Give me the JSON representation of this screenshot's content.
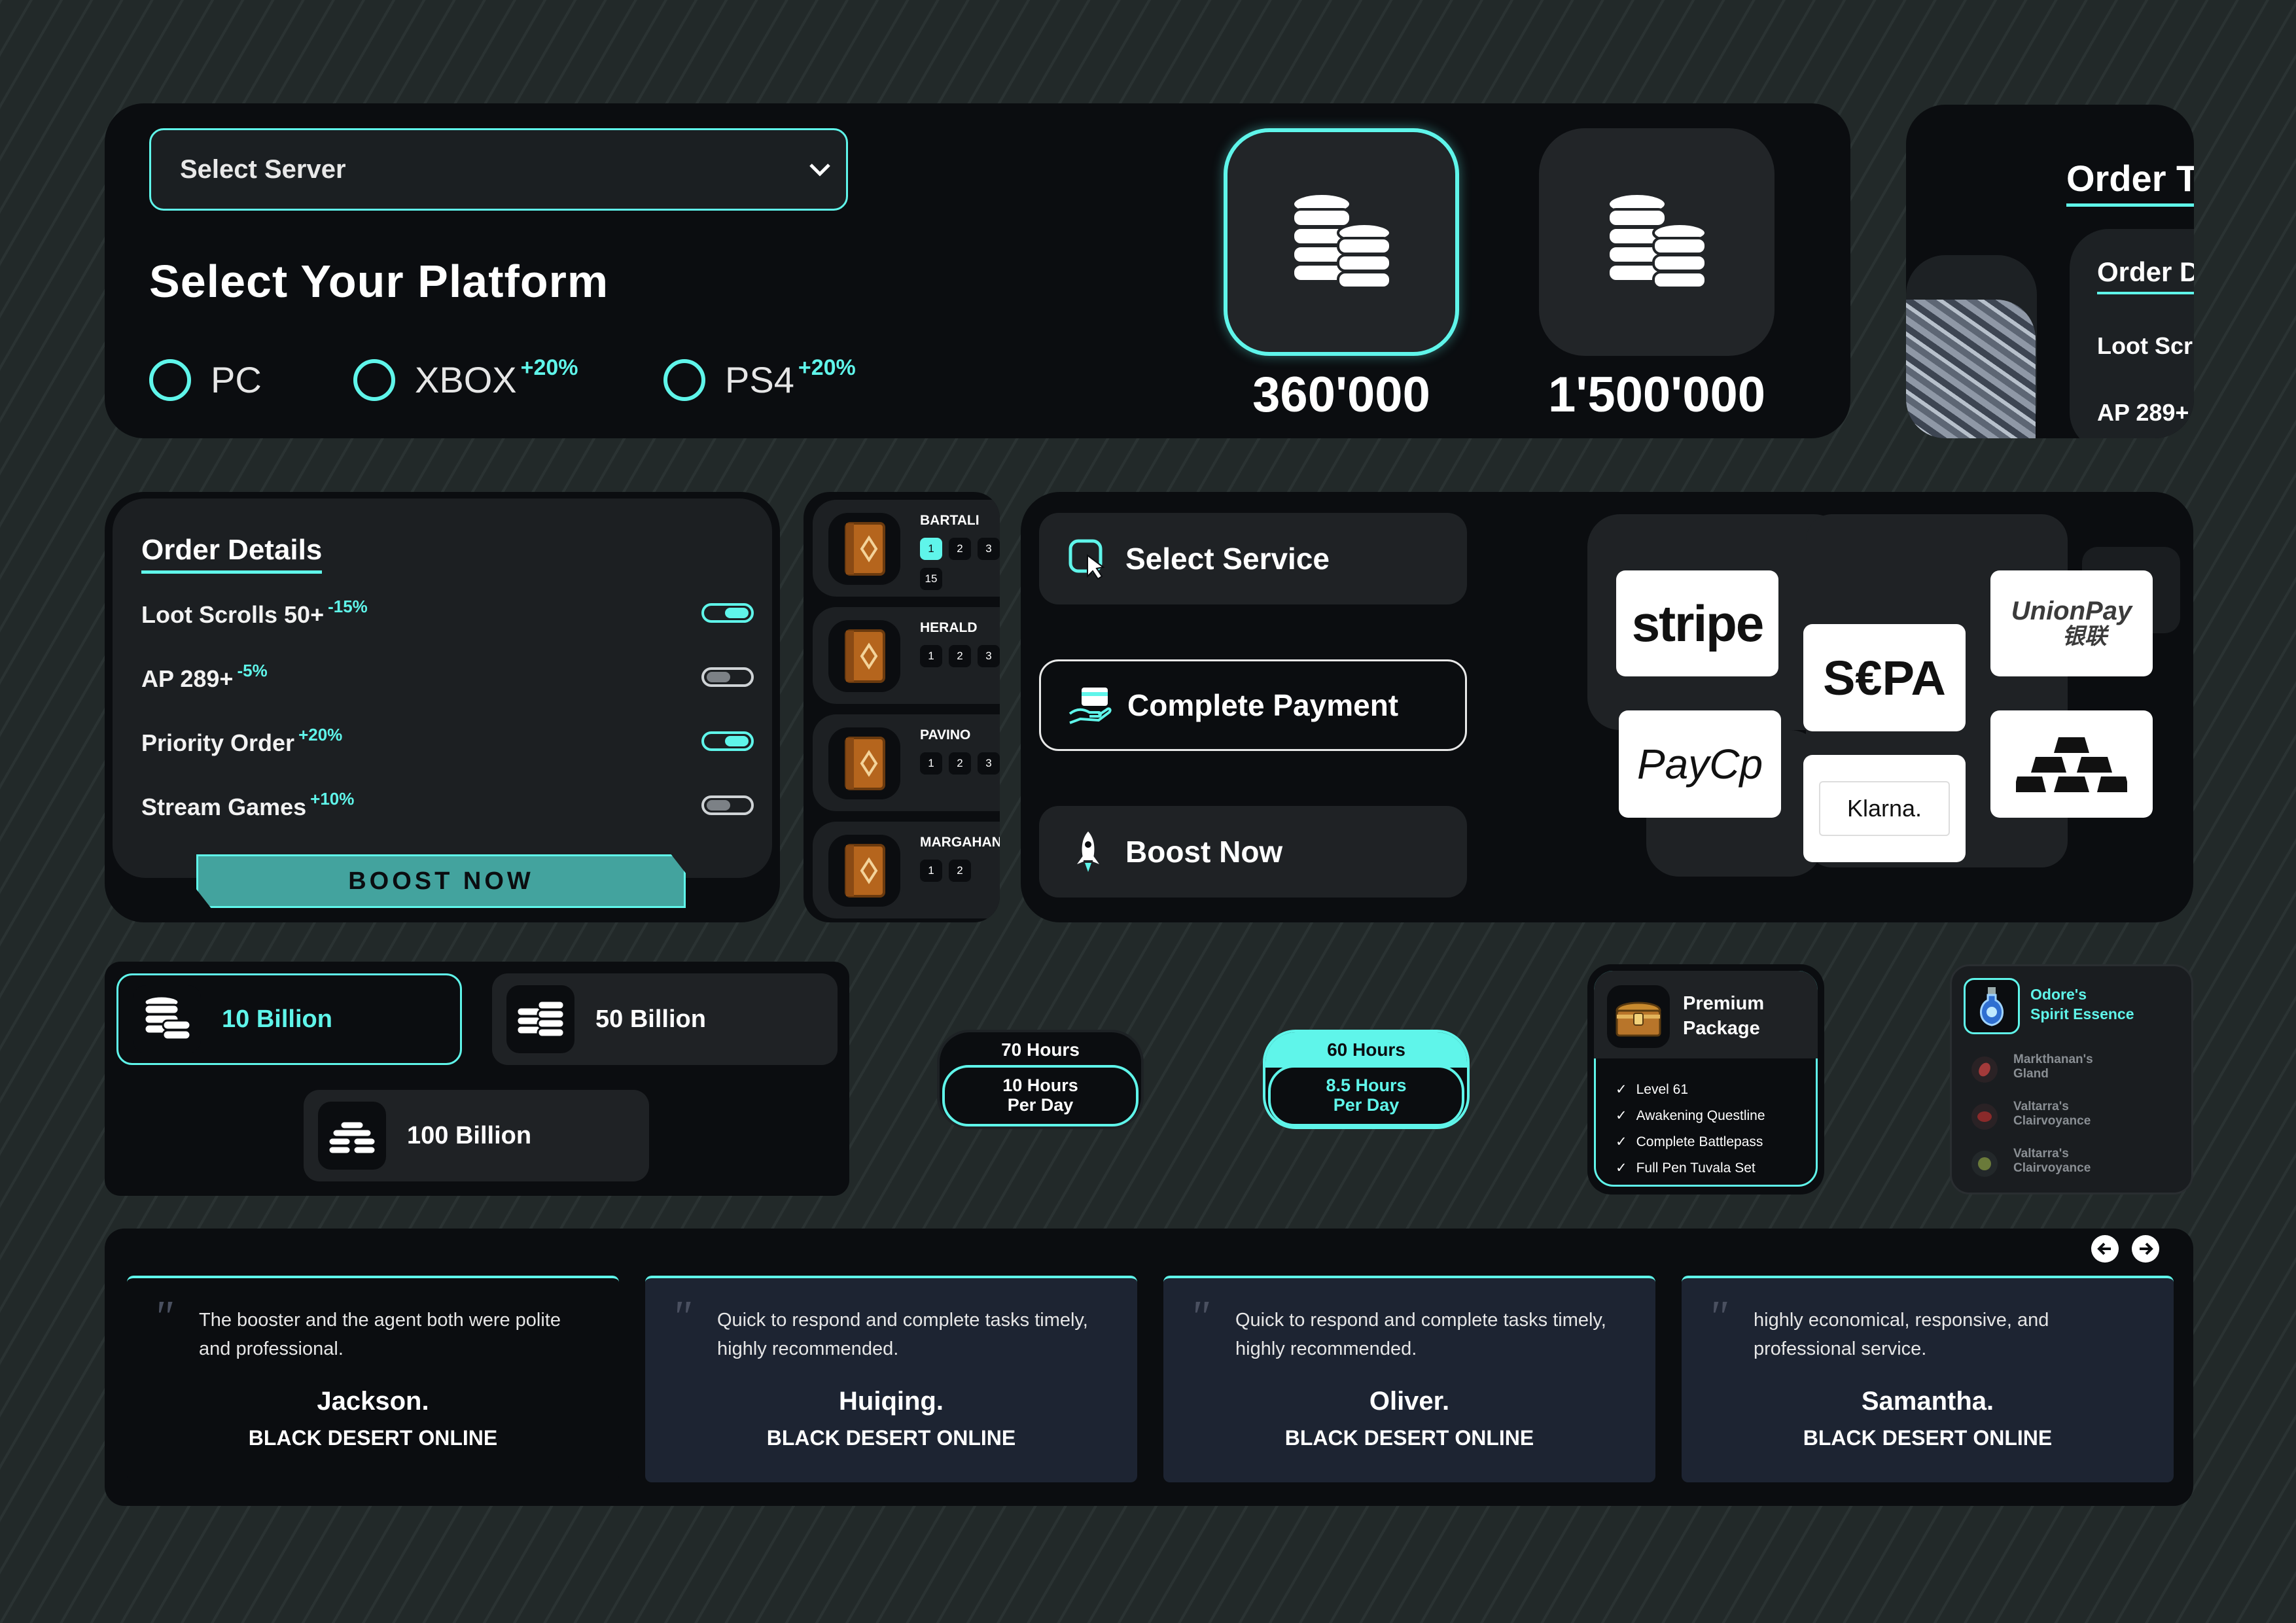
{
  "server_select": {
    "label": "Select Server"
  },
  "platform": {
    "title": "Select Your Platform",
    "options": [
      {
        "label": "PC",
        "bonus": ""
      },
      {
        "label": "XBOX",
        "bonus": "+20%"
      },
      {
        "label": "PS4",
        "bonus": "+20%"
      }
    ]
  },
  "coins": [
    {
      "amount": "360'000",
      "selected": true
    },
    {
      "amount": "1'500'000",
      "selected": false
    }
  ],
  "cropped_order": {
    "title": "Order T",
    "subtitle": "Order D",
    "line1": "Loot Scr",
    "line2": "AP 289+"
  },
  "order_details": {
    "title": "Order Details",
    "items": [
      {
        "label": "Loot Scrolls 50+",
        "mod": "-15%",
        "on": true
      },
      {
        "label": "AP 289+",
        "mod": "-5%",
        "on": false
      },
      {
        "label": "Priority Order",
        "mod": "+20%",
        "on": true
      },
      {
        "label": "Stream Games",
        "mod": "+10%",
        "on": false
      }
    ],
    "button": "BOOST NOW"
  },
  "books": [
    {
      "name": "BARTALI",
      "pages": [
        "1",
        "2",
        "3",
        "15"
      ]
    },
    {
      "name": "HERALD",
      "pages": [
        "1",
        "2",
        "3"
      ]
    },
    {
      "name": "PAVINO",
      "pages": [
        "1",
        "2",
        "3"
      ]
    },
    {
      "name": "MARGAHAN",
      "pages": [
        "1",
        "2"
      ]
    }
  ],
  "steps": [
    {
      "label": "Select Service",
      "icon": "cursor-target-icon"
    },
    {
      "label": "Complete Payment",
      "icon": "card-hand-icon"
    },
    {
      "label": "Boost Now",
      "icon": "rocket-icon"
    }
  ],
  "payments": {
    "stripe": "stripe",
    "sepa": "S€PA",
    "unionpay": "UnionPay",
    "unionpay_cn": "银联",
    "paycop": "PayCp",
    "klarna": "Klarna.",
    "gold_icon": "gold-bars-icon"
  },
  "billions": [
    {
      "label": "10 Billion",
      "selected": true
    },
    {
      "label": "50 Billion",
      "selected": false
    },
    {
      "label": "100 Billion",
      "selected": false
    }
  ],
  "hours": [
    {
      "total": "70 Hours",
      "per_day_value": "10 Hours",
      "per_day_unit": "Per Day",
      "selected": false
    },
    {
      "total": "60 Hours",
      "per_day_value": "8.5 Hours",
      "per_day_unit": "Per Day",
      "selected": true
    }
  ],
  "premium": {
    "title_line1": "Premium",
    "title_line2": "Package",
    "items": [
      "Level 61",
      "Awakening Questline",
      "Complete Battlepass",
      "Full Pen Tuvala Set"
    ]
  },
  "spirit": {
    "title_line1": "Odore's",
    "title_line2": "Spirit Essence",
    "items": [
      {
        "line1": "Markthanan's",
        "line2": "Gland"
      },
      {
        "line1": "Valtarra's",
        "line2": "Clairvoyance"
      },
      {
        "line1": "Valtarra's",
        "line2": "Clairvoyance"
      }
    ]
  },
  "testimonials": [
    {
      "text": "The booster and the agent both were polite and professional.",
      "name": "Jackson.",
      "game": "BLACK DESERT ONLINE"
    },
    {
      "text": "Quick to respond and complete tasks timely, highly recommended.",
      "name": "Huiqing.",
      "game": "BLACK DESERT ONLINE"
    },
    {
      "text": "Quick to respond and complete tasks timely, highly recommended.",
      "name": "Oliver.",
      "game": "BLACK DESERT ONLINE"
    },
    {
      "text": "highly economical, responsive, and professional service.",
      "name": "Samantha.",
      "game": "BLACK DESERT ONLINE"
    }
  ],
  "colors": {
    "accent": "#5ff5ea",
    "panel": "#0b0d10",
    "card": "#1f2225"
  }
}
